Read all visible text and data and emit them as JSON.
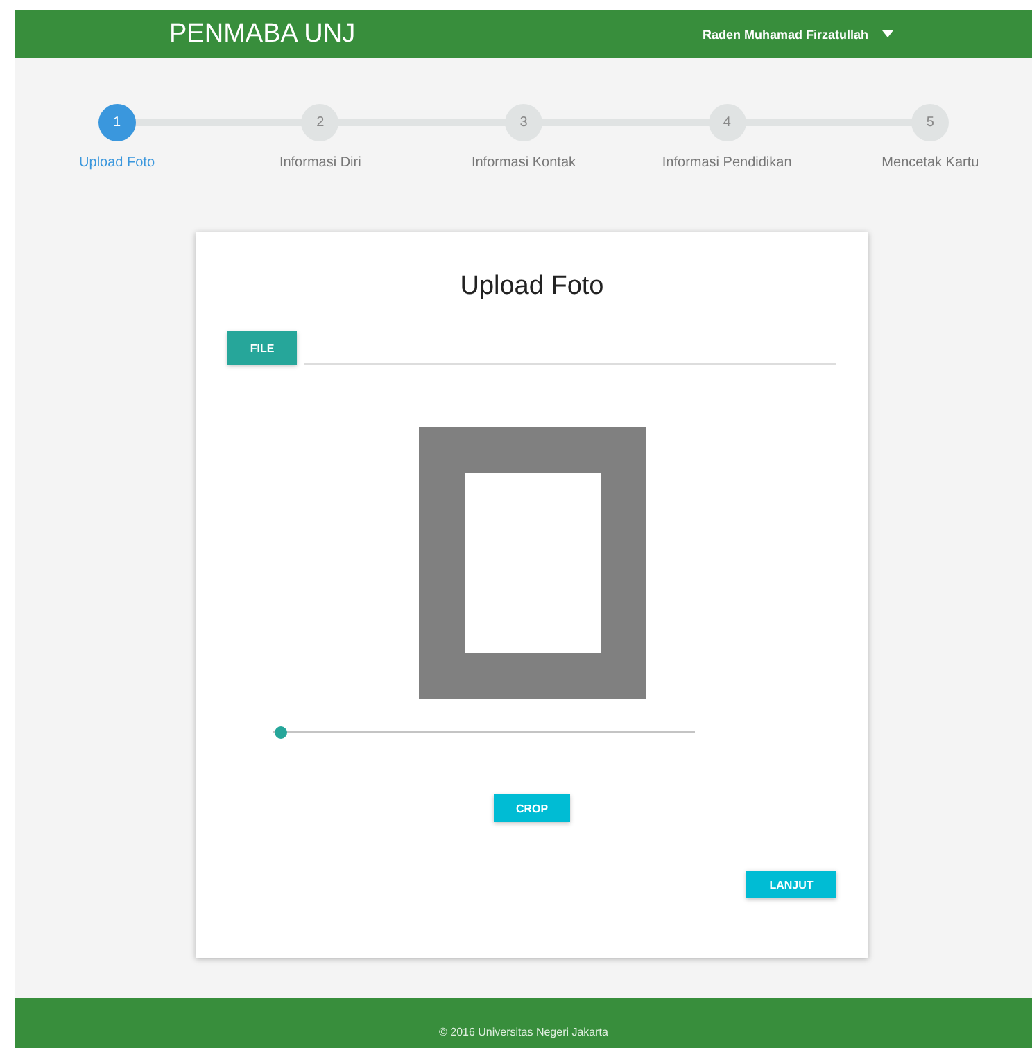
{
  "header": {
    "title": "PENMABA UNJ",
    "user": "Raden Muhamad Firzatullah"
  },
  "steps": [
    {
      "number": "1",
      "label": "Upload Foto",
      "selected": true
    },
    {
      "number": "2",
      "label": "Informasi Diri",
      "selected": false
    },
    {
      "number": "3",
      "label": "Informasi Kontak",
      "selected": false
    },
    {
      "number": "4",
      "label": "Informasi Pendidikan",
      "selected": false
    },
    {
      "number": "5",
      "label": "Mencetak Kartu",
      "selected": false
    }
  ],
  "card": {
    "title": "Upload Foto",
    "file_button": "FILE",
    "zoom_slider": {
      "level": 0.02
    },
    "crop_button": "CROP",
    "next_button": "LANJUT"
  },
  "footer": "© 2016 Universitas Negeri Jakarta"
}
